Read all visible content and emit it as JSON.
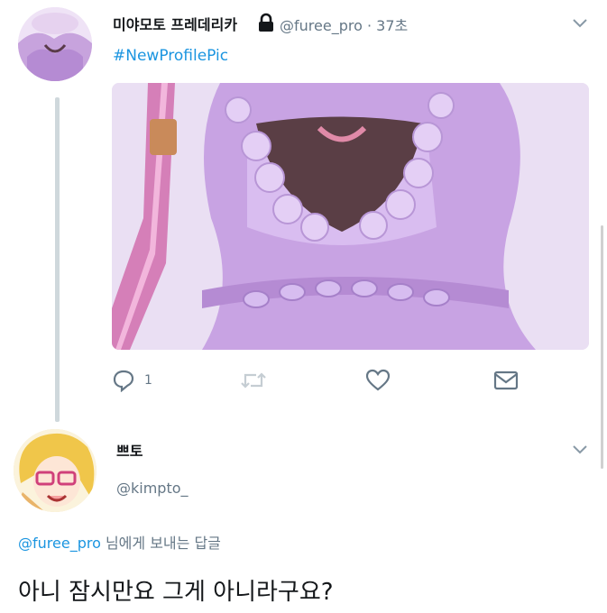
{
  "tweet": {
    "display_name": "미야모토 프레데리카",
    "handle": "@furee_pro",
    "separator": "·",
    "time": "37초",
    "hashtag": "#NewProfilePic",
    "reply_count": "1"
  },
  "reply": {
    "display_name": "쁘토",
    "handle": "@kimpto_",
    "replying_to_handle": "@furee_pro",
    "replying_to_suffix": "님에게 보내는 답글",
    "text": "아니 잠시만요 그게 아니라구요?"
  },
  "colors": {
    "link_blue": "#1b95e0",
    "secondary_gray": "#657786",
    "thread_line": "#cfd8dc"
  },
  "icons": [
    "lock-icon",
    "chevron-down-icon",
    "reply-icon",
    "retweet-icon",
    "like-icon",
    "direct-message-icon"
  ]
}
